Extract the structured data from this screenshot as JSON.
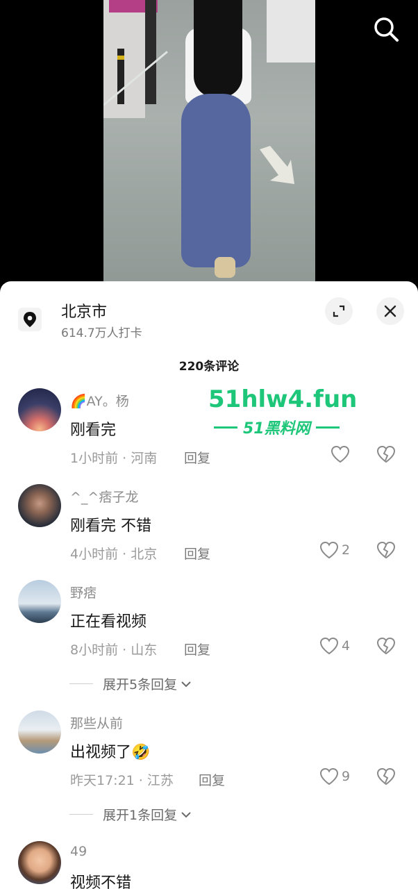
{
  "video": {
    "search_icon": "search-icon"
  },
  "location": {
    "name": "北京市",
    "checkins": "614.7万人打卡",
    "icons": [
      "location-pin-icon",
      "expand-icon",
      "close-icon"
    ]
  },
  "comments_header": {
    "count_label": "220条评论"
  },
  "watermark": {
    "main": "51hlw4.fun",
    "sub": "51黑料网",
    "color": "#1ec67a"
  },
  "comments": [
    {
      "user": "🌈AY。杨",
      "text": "刚看完",
      "meta": "1小时前 · 河南",
      "reply": "回复",
      "likes": ""
    },
    {
      "user": "^_^痞子龙",
      "text": "刚看完 不错",
      "meta": "4小时前 · 北京",
      "reply": "回复",
      "likes": "2"
    },
    {
      "user": "野痞",
      "text": "正在看视频",
      "meta": "8小时前 · 山东",
      "reply": "回复",
      "likes": "4",
      "expand": "展开5条回复"
    },
    {
      "user": "那些从前",
      "text": "出视频了🤣",
      "meta": "昨天17:21 · 江苏",
      "reply": "回复",
      "likes": "9",
      "expand": "展开1条回复"
    },
    {
      "user": "49",
      "text": "视频不错",
      "meta": "",
      "reply": "",
      "likes": ""
    }
  ]
}
